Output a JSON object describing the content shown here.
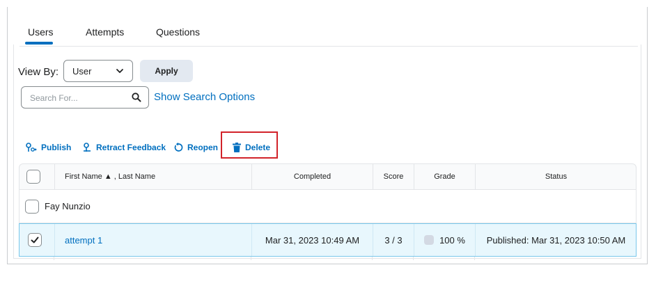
{
  "tabs": [
    {
      "label": "Users",
      "active": true
    },
    {
      "label": "Attempts",
      "active": false
    },
    {
      "label": "Questions",
      "active": false
    }
  ],
  "view_by": {
    "label": "View By:",
    "selected": "User",
    "apply_label": "Apply"
  },
  "search": {
    "placeholder": "Search For...",
    "value": "",
    "show_options_label": "Show Search Options"
  },
  "actions": {
    "publish": "Publish",
    "retract_feedback": "Retract Feedback",
    "reopen": "Reopen",
    "delete": "Delete"
  },
  "table": {
    "headers": {
      "name": "First Name ▲ , Last Name",
      "completed": "Completed",
      "score": "Score",
      "grade": "Grade",
      "status": "Status"
    },
    "groups": [
      {
        "name": "Fay Nunzio",
        "checked": false,
        "rows": [
          {
            "attempt": "attempt 1",
            "completed": "Mar 31, 2023 10:49 AM",
            "score": "3 / 3",
            "grade": "100 %",
            "status": "Published: Mar 31, 2023 10:50 AM",
            "checked": true
          }
        ]
      }
    ]
  },
  "colors": {
    "accent": "#006fbf",
    "highlight_border": "#d2232a",
    "selected_row_bg": "#e8f7fd"
  }
}
